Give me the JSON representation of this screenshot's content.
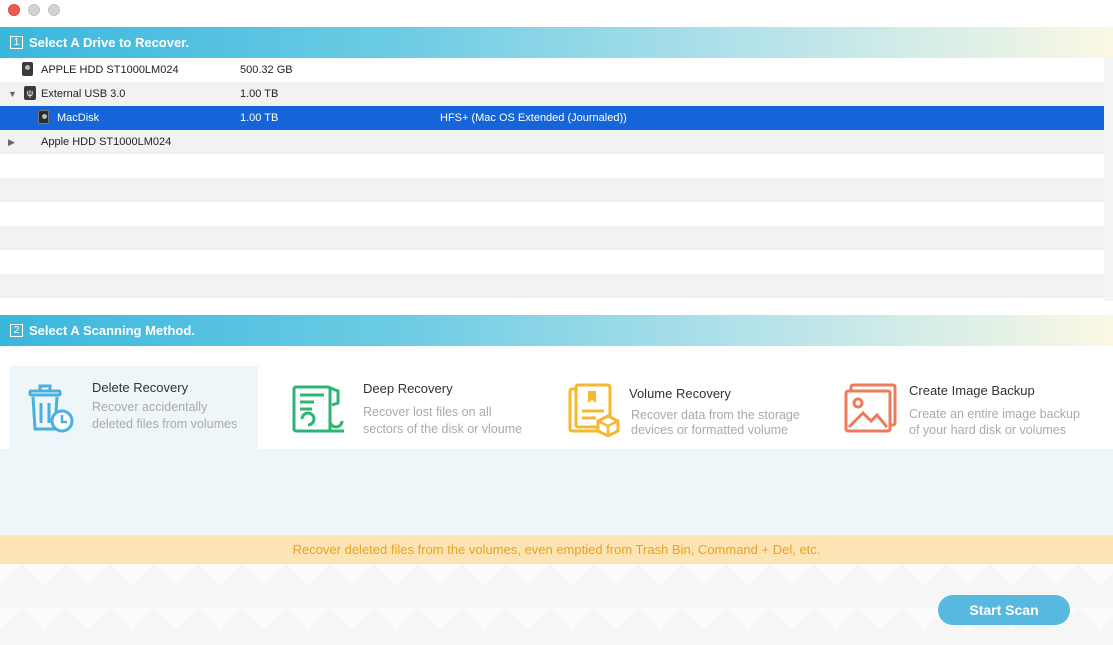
{
  "step1": {
    "num": "1",
    "title": "Select A Drive to Recover."
  },
  "step2": {
    "num": "2",
    "title": "Select A Scanning Method."
  },
  "drives": [
    {
      "name": "APPLE HDD ST1000LM024",
      "size": "500.32 GB",
      "fs": ""
    },
    {
      "name": "External USB 3.0",
      "size": "1.00 TB",
      "fs": ""
    },
    {
      "name": "MacDisk",
      "size": "1.00 TB",
      "fs": "HFS+ (Mac OS Extended (Journaled))"
    },
    {
      "name": "Apple HDD ST1000LM024",
      "size": "",
      "fs": ""
    }
  ],
  "methods": [
    {
      "title": "Delete Recovery",
      "desc1": "Recover accidentally",
      "desc2": "deleted files from volumes",
      "color": "#4ab0e0",
      "icon": "trash-clock-icon"
    },
    {
      "title": "Deep Recovery",
      "desc1": "Recover lost files on all",
      "desc2": "sectors of the disk or vloume",
      "color": "#2bb673",
      "icon": "document-scan-icon"
    },
    {
      "title": "Volume Recovery",
      "desc1": "Recover data from the storage",
      "desc2": "devices or formatted volume",
      "color": "#f5b731",
      "icon": "folder-box-icon"
    },
    {
      "title": "Create Image Backup",
      "desc1": "Create an entire image backup",
      "desc2": "of your hard disk or volumes",
      "color": "#ee7a5c",
      "icon": "image-backup-icon"
    }
  ],
  "hint": "Recover deleted files from the volumes, even emptied from Trash Bin, Command + Del, etc.",
  "start_button": "Start Scan"
}
